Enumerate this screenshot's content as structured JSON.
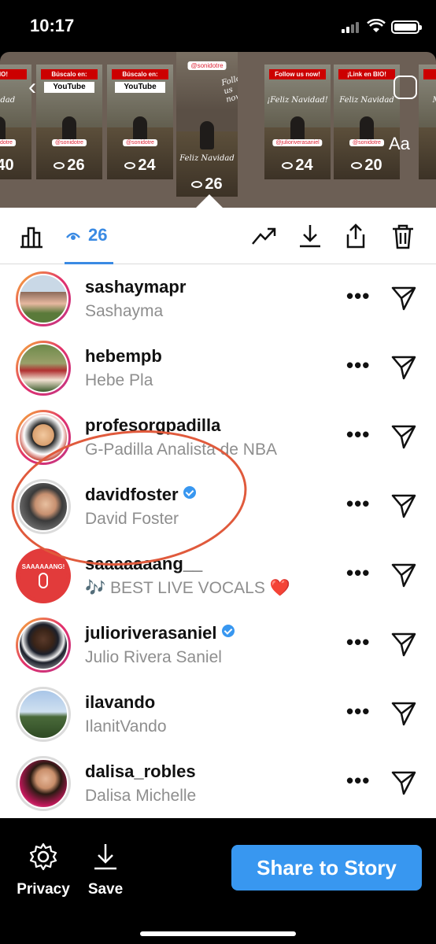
{
  "status_bar": {
    "time": "10:17"
  },
  "story_strip": {
    "aa_label": "Aa",
    "thumbnails": [
      {
        "top_text": "n BIO!",
        "sub": "Navidad",
        "tag": "@sonidotre",
        "views": "40"
      },
      {
        "top_text": "Búscalo en:",
        "sub": "YouTube",
        "tag": "@sonidotre",
        "views": "26"
      },
      {
        "top_text": "Búscalo en:",
        "sub": "YouTube",
        "tag": "@sonidotre",
        "views": "24"
      },
      {
        "top_text": "@sonidotre",
        "sub": "Feliz Navidad",
        "tag": "@sonidotre",
        "views": "26",
        "follow": "Follow us now!"
      },
      {
        "top_text": "Follow us now!",
        "sub": "¡Feliz Navidad!",
        "tag": "@julioriverasaniel",
        "views": "24"
      },
      {
        "top_text": "¡Link en BIO!",
        "sub": "Feliz Navidad",
        "tag": "@sonidotre",
        "views": "20"
      },
      {
        "top_text": "BIO!",
        "sub": "Merry Ch",
        "tag": "",
        "views": ""
      }
    ]
  },
  "toolbar": {
    "viewer_count": "26"
  },
  "viewers": [
    {
      "username": "sashaymapr",
      "fullname": "Sashayma",
      "verified": false
    },
    {
      "username": "hebempb",
      "fullname": "Hebe Pla",
      "verified": false
    },
    {
      "username": "profesorgpadilla",
      "fullname": "G-Padilla Analista de NBA",
      "verified": false
    },
    {
      "username": "davidfoster",
      "fullname": "David Foster",
      "verified": true
    },
    {
      "username": "saaaaaaang__",
      "fullname": "🎶 BEST LIVE VOCALS ❤️",
      "verified": false,
      "avatar_text": "SAAAAAANG!"
    },
    {
      "username": "julioriverasaniel",
      "fullname": "Julio Rivera Saniel",
      "verified": true
    },
    {
      "username": "ilavando",
      "fullname": "IlanitVando",
      "verified": false
    },
    {
      "username": "dalisa_robles",
      "fullname": "Dalisa Michelle",
      "verified": false
    }
  ],
  "bottom": {
    "privacy_label": "Privacy",
    "save_label": "Save",
    "share_label": "Share to Story"
  },
  "colors": {
    "accent": "#3897f0",
    "annotation": "#e05a3c"
  }
}
